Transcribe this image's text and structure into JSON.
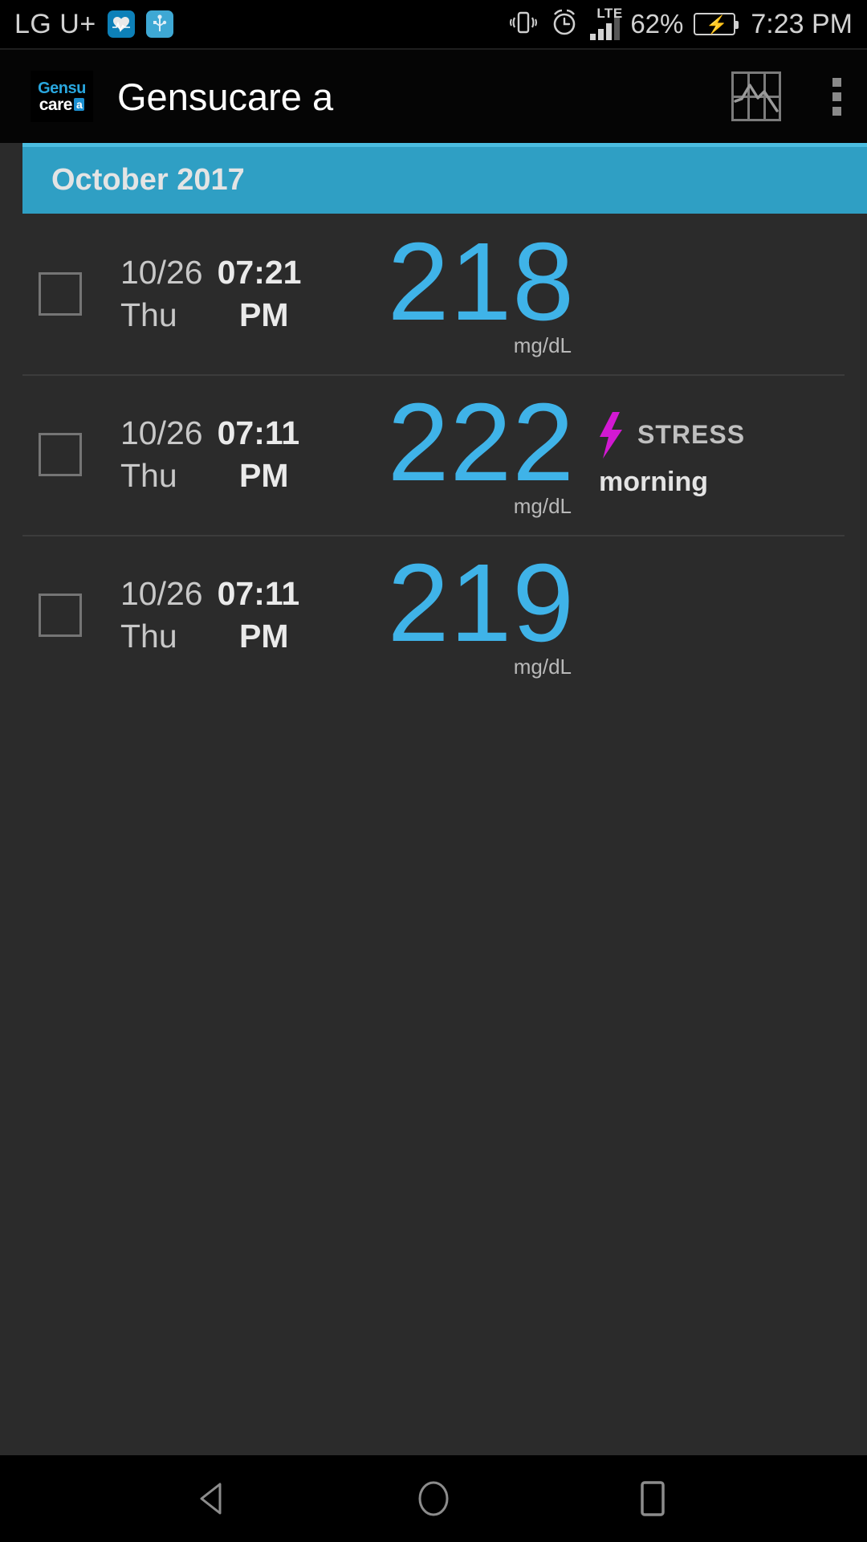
{
  "status_bar": {
    "carrier": "LG U+",
    "icons": [
      "heart-rate-app-icon",
      "usb-icon",
      "vibrate-icon",
      "alarm-icon"
    ],
    "network_type": "LTE",
    "battery_percent": "62%",
    "clock": "7:23 PM"
  },
  "app_bar": {
    "logo_line1": "Gensu",
    "logo_line2": "care",
    "logo_badge": "a",
    "title": "Gensucare a",
    "actions": [
      "chart-icon",
      "overflow-menu-icon"
    ]
  },
  "list": {
    "month_header": "October 2017",
    "unit": "mg/dL",
    "readings": [
      {
        "date": "10/26",
        "day": "Thu",
        "time": "07:21",
        "ampm": "PM",
        "value": "218",
        "unit": "mg/dL",
        "tag": null,
        "tag_sub": null
      },
      {
        "date": "10/26",
        "day": "Thu",
        "time": "07:11",
        "ampm": "PM",
        "value": "222",
        "unit": "mg/dL",
        "tag": "STRESS",
        "tag_sub": "morning"
      },
      {
        "date": "10/26",
        "day": "Thu",
        "time": "07:11",
        "ampm": "PM",
        "value": "219",
        "unit": "mg/dL",
        "tag": null,
        "tag_sub": null
      }
    ]
  },
  "nav_bar": {
    "back": "back-nav-button",
    "home": "home-nav-button",
    "recents": "recents-nav-button"
  },
  "colors": {
    "accent_blue": "#3fb3e8",
    "header_blue": "#2f9fc4",
    "header_blue_light": "#4bbde0",
    "stress_magenta": "#d219d2",
    "background": "#2b2b2b",
    "battery_green": "#49b326"
  }
}
